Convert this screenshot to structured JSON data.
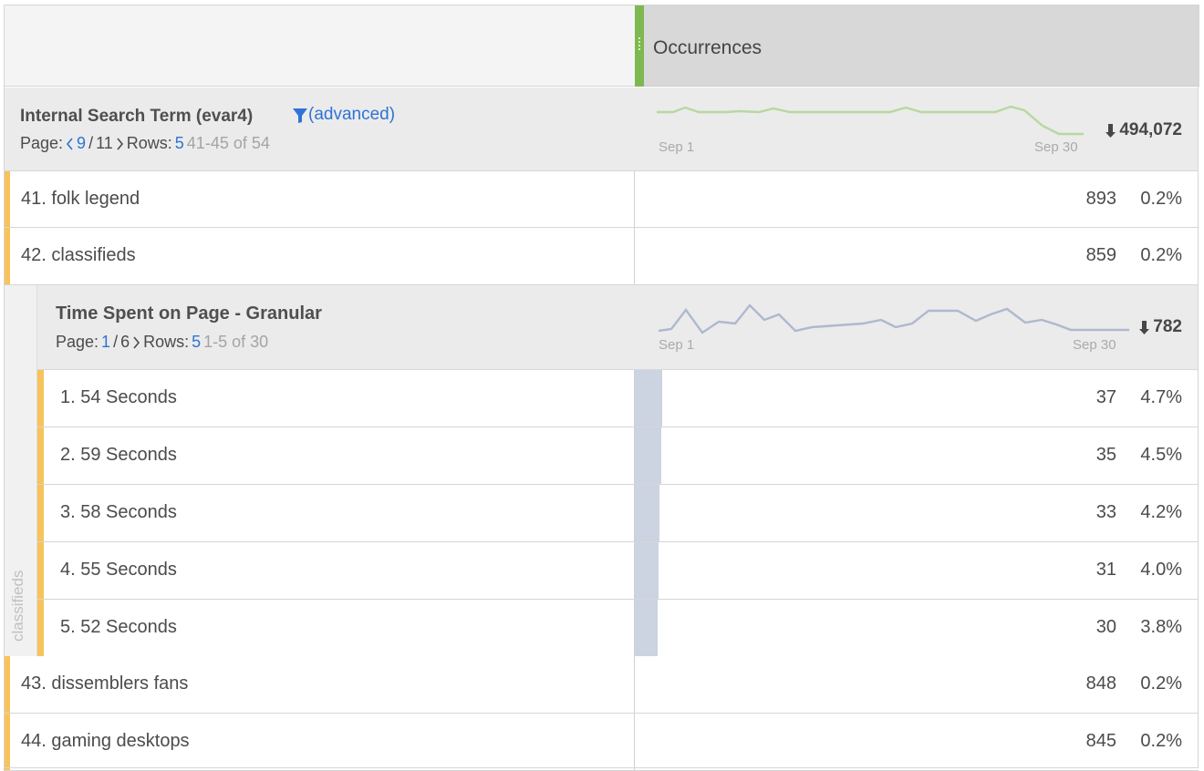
{
  "metric": {
    "title": "Occurrences",
    "accent_color": "#7eb851"
  },
  "primary": {
    "title": "Internal Search Term (evar4)",
    "filter_icon": "funnel-icon",
    "filter_label": "(advanced)",
    "page_label": "Page:",
    "current_page": "9",
    "page_separator": "/",
    "page_count": "11",
    "rows_label": "Rows:",
    "rows_value": "5",
    "range": "41-45 of 54",
    "spark_start": "Sep 1",
    "spark_end": "Sep 30",
    "total": "494,072",
    "trend_color": "#b7d8a0"
  },
  "rows": [
    {
      "label": "41.  folk legend",
      "occurrences": "893",
      "percent": "0.2%"
    },
    {
      "label": "42.  classifieds",
      "occurrences": "859",
      "percent": "0.2%"
    },
    {
      "label": "43.  dissemblers fans",
      "occurrences": "848",
      "percent": "0.2%"
    },
    {
      "label": "44.  gaming desktops",
      "occurrences": "845",
      "percent": "0.2%"
    }
  ],
  "nested": {
    "parent": "classifieds",
    "title": "Time Spent on Page - Granular",
    "page_label": "Page:",
    "current_page": "1",
    "page_separator": "/",
    "page_count": "6",
    "rows_label": "Rows:",
    "rows_value": "5",
    "range": "1-5 of 30",
    "spark_start": "Sep 1",
    "spark_end": "Sep 30",
    "total": "782",
    "trend_color": "#aeb8d0",
    "bar_color": "#ccd3e1",
    "rows": [
      {
        "label": "1.    54 Seconds",
        "occurrences": "37",
        "percent": "4.7%"
      },
      {
        "label": "2.    59 Seconds",
        "occurrences": "35",
        "percent": "4.5%"
      },
      {
        "label": "3.    58 Seconds",
        "occurrences": "33",
        "percent": "4.2%"
      },
      {
        "label": "4.    55 Seconds",
        "occurrences": "31",
        "percent": "4.0%"
      },
      {
        "label": "5.    52 Seconds",
        "occurrences": "30",
        "percent": "3.8%"
      }
    ]
  }
}
